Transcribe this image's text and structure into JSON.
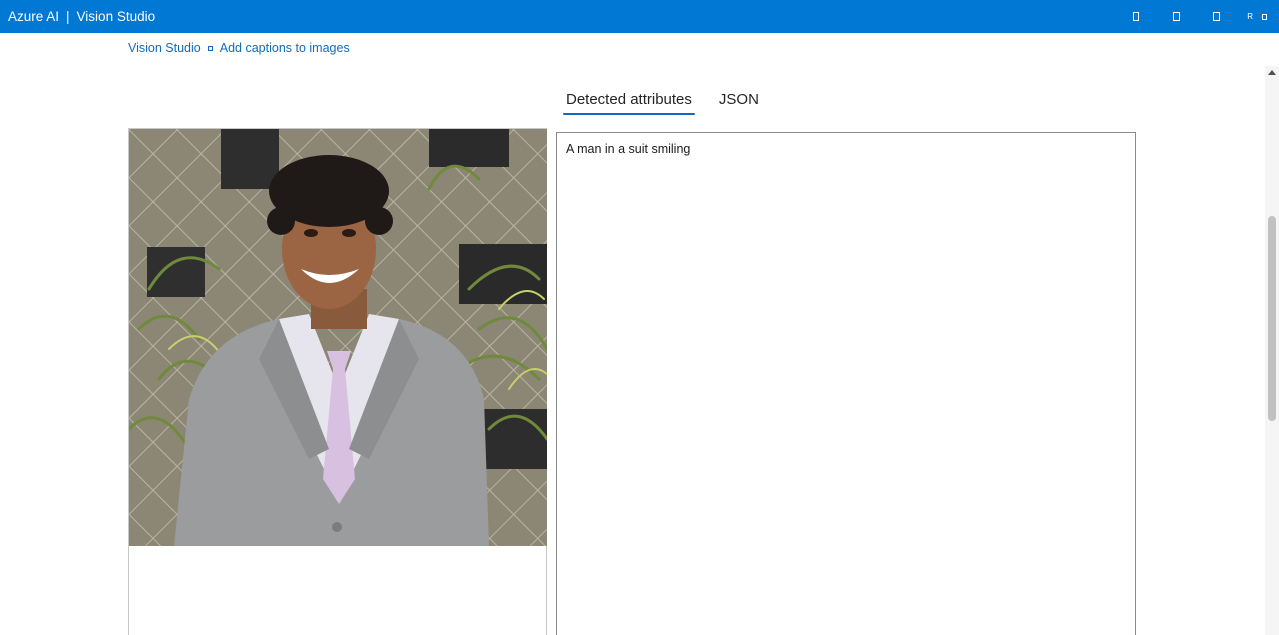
{
  "header": {
    "brand_left": "Azure AI",
    "brand_sep": "|",
    "brand_right": "Vision Studio",
    "avatar_initial": "R",
    "icons": [
      "notification-icon",
      "settings-icon",
      "help-icon",
      "account-icon"
    ]
  },
  "breadcrumb": {
    "items": [
      {
        "label": "Vision Studio"
      },
      {
        "label": "Add captions to images"
      }
    ]
  },
  "tabs": [
    {
      "label": "Detected attributes",
      "active": true
    },
    {
      "label": "JSON",
      "active": false
    }
  ],
  "result": {
    "caption": "A man in a suit smiling"
  },
  "colors": {
    "header_bg": "#0078d4",
    "link": "#0f6cbd",
    "tab_underline": "#0f6cbd"
  }
}
